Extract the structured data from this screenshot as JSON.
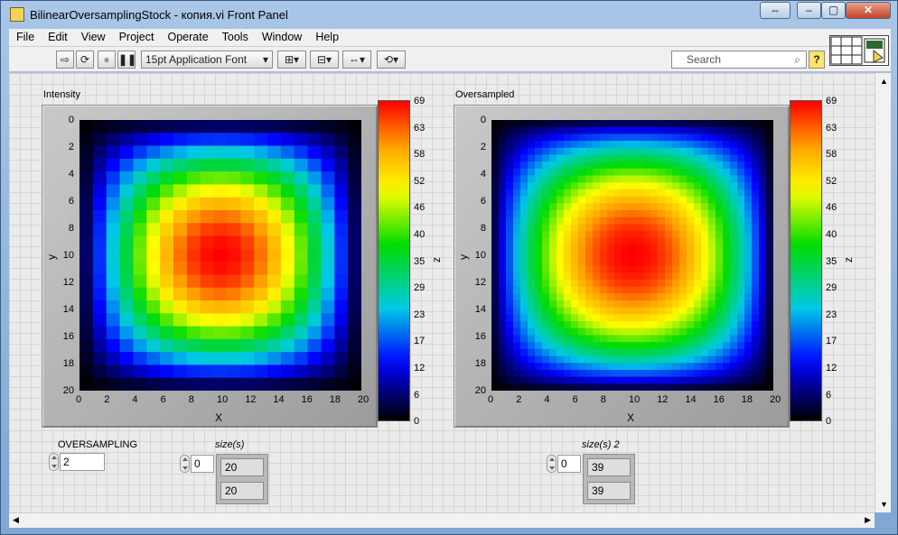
{
  "window": {
    "title": "BilinearOversamplingStock - копия.vi Front Panel",
    "buttons": [
      "⇔",
      "–",
      "▢",
      "✕"
    ]
  },
  "menu": [
    "File",
    "Edit",
    "View",
    "Project",
    "Operate",
    "Tools",
    "Window",
    "Help"
  ],
  "toolbar": {
    "font": "15pt Application Font",
    "search_placeholder": "Search",
    "help": "?"
  },
  "graphs": [
    {
      "title": "Intensity",
      "xlabel": "X",
      "ylabel": "y",
      "zlabel": "z",
      "resolution": 21,
      "sharp": true
    },
    {
      "title": "Oversampled",
      "xlabel": "X",
      "ylabel": "y",
      "zlabel": "z",
      "resolution": 39,
      "sharp": false
    }
  ],
  "axis_ticks": [
    "0",
    "2",
    "4",
    "6",
    "8",
    "10",
    "12",
    "14",
    "16",
    "18",
    "20"
  ],
  "colorbar_ticks": [
    "69",
    "63",
    "58",
    "52",
    "46",
    "40",
    "35",
    "29",
    "23",
    "17",
    "12",
    "6",
    "0"
  ],
  "controls": {
    "oversampling_label": "OVERSAMPLING",
    "oversampling_value": "2",
    "size1_label": "size(s)",
    "size1_index": "0",
    "size1_values": [
      "20",
      "20"
    ],
    "size2_label": "size(s) 2",
    "size2_index": "0",
    "size2_values": [
      "39",
      "39"
    ]
  },
  "chart_data": {
    "type": "heatmap",
    "charts": [
      {
        "title": "Intensity",
        "xlim": [
          0,
          20
        ],
        "ylim": [
          0,
          20
        ],
        "zlim": [
          0,
          69
        ],
        "xlabel": "X",
        "ylabel": "y",
        "zlabel": "z"
      },
      {
        "title": "Oversampled",
        "xlim": [
          0,
          20
        ],
        "ylim": [
          0,
          20
        ],
        "zlim": [
          0,
          69
        ],
        "xlabel": "X",
        "ylabel": "y",
        "zlabel": "z"
      }
    ]
  }
}
